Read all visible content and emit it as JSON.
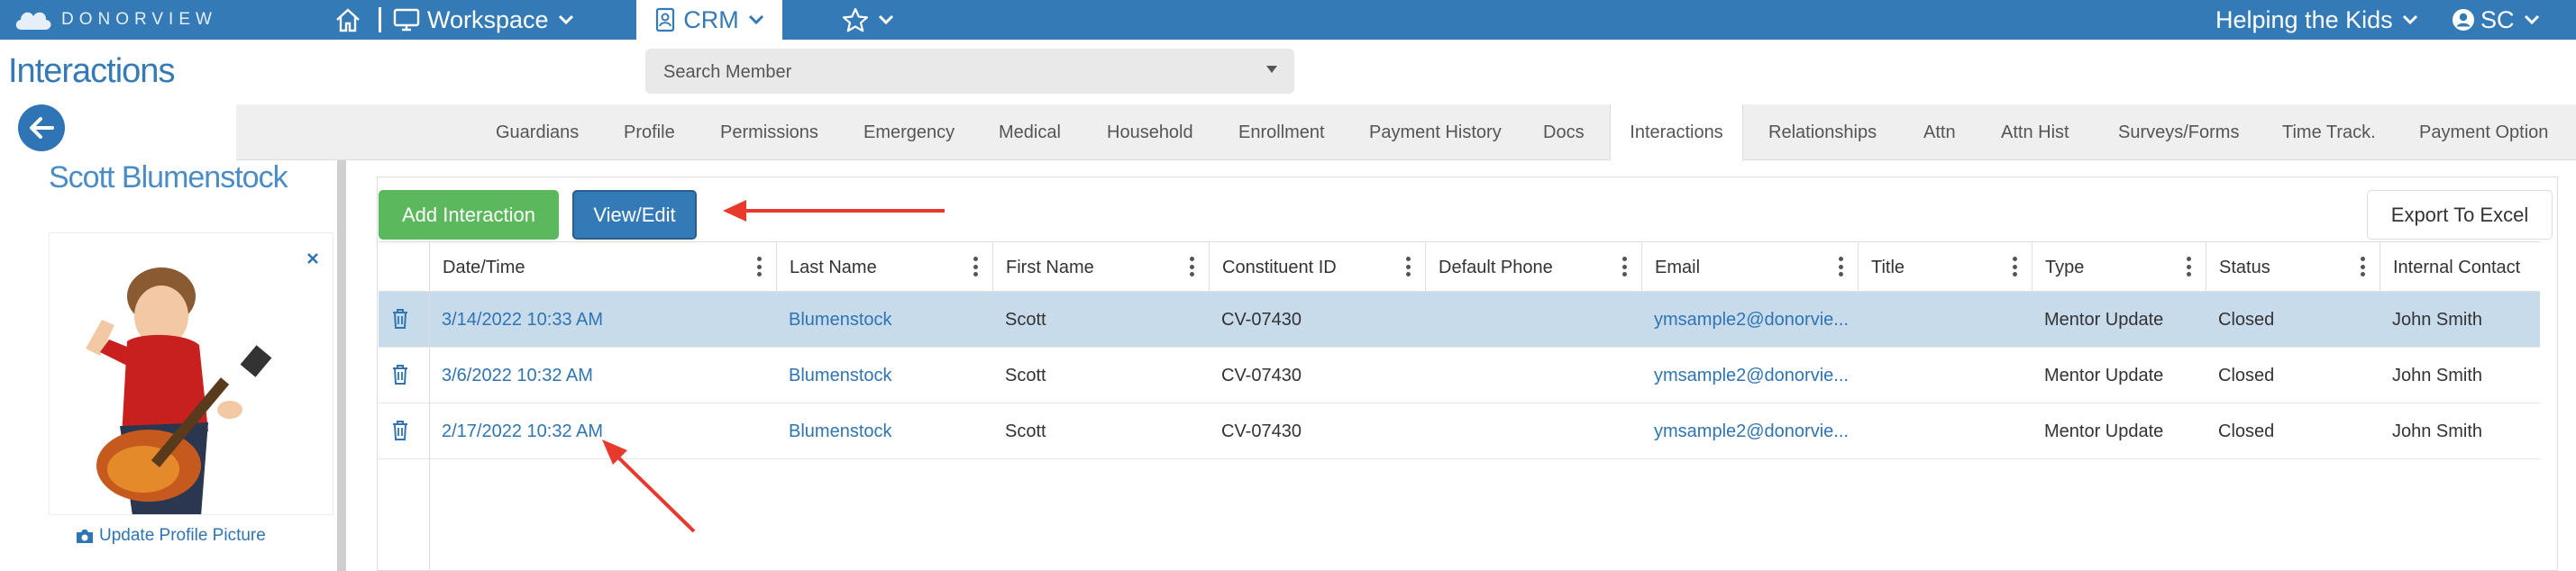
{
  "topbar": {
    "logo_text": "DONORVIEW",
    "workspace_label": "Workspace",
    "crm_label": "CRM",
    "org_label": "Helping the Kids",
    "user_label": "SC"
  },
  "page": {
    "title": "Interactions",
    "search_placeholder": "Search Member"
  },
  "tabs": [
    {
      "label": "Guardians"
    },
    {
      "label": "Profile"
    },
    {
      "label": "Permissions"
    },
    {
      "label": "Emergency"
    },
    {
      "label": "Medical"
    },
    {
      "label": "Household"
    },
    {
      "label": "Enrollment"
    },
    {
      "label": "Payment History"
    },
    {
      "label": "Docs"
    },
    {
      "label": "Interactions"
    },
    {
      "label": "Relationships"
    },
    {
      "label": "Attn"
    },
    {
      "label": "Attn Hist"
    },
    {
      "label": "Surveys/Forms"
    },
    {
      "label": "Time Track."
    },
    {
      "label": "Payment Option"
    }
  ],
  "member": {
    "name": "Scott Blumenstock",
    "update_picture_label": "Update Profile Picture"
  },
  "toolbar": {
    "add_label": "Add Interaction",
    "view_edit_label": "View/Edit",
    "export_label": "Export To Excel"
  },
  "grid": {
    "columns": [
      "Date/Time",
      "Last Name",
      "First Name",
      "Constituent ID",
      "Default Phone",
      "Email",
      "Title",
      "Type",
      "Status",
      "Internal Contact"
    ],
    "rows": [
      {
        "date": "3/14/2022 10:33 AM",
        "last": "Blumenstock",
        "first": "Scott",
        "cid": "CV-07430",
        "phone": "",
        "email": "ymsample2@donorvie...",
        "title": "",
        "type": "Mentor Update",
        "status": "Closed",
        "contact": "John Smith",
        "selected": true
      },
      {
        "date": "3/6/2022 10:32 AM",
        "last": "Blumenstock",
        "first": "Scott",
        "cid": "CV-07430",
        "phone": "",
        "email": "ymsample2@donorvie...",
        "title": "",
        "type": "Mentor Update",
        "status": "Closed",
        "contact": "John Smith",
        "selected": false
      },
      {
        "date": "2/17/2022 10:32 AM",
        "last": "Blumenstock",
        "first": "Scott",
        "cid": "CV-07430",
        "phone": "",
        "email": "ymsample2@donorvie...",
        "title": "",
        "type": "Mentor Update",
        "status": "Closed",
        "contact": "John Smith",
        "selected": false
      }
    ]
  },
  "colors": {
    "brand_blue": "#337ab7",
    "add_green": "#5cb85c",
    "selected_row": "#c8dbea",
    "annotation_red": "#e8392d"
  },
  "icons": {
    "home": "home-icon",
    "workspace": "monitor-icon",
    "crm": "contact-card-icon",
    "favorites": "star-icon",
    "user": "user-circle-icon",
    "back": "arrow-left-icon",
    "delete": "trash-icon",
    "close": "close-icon",
    "camera": "camera-icon"
  }
}
